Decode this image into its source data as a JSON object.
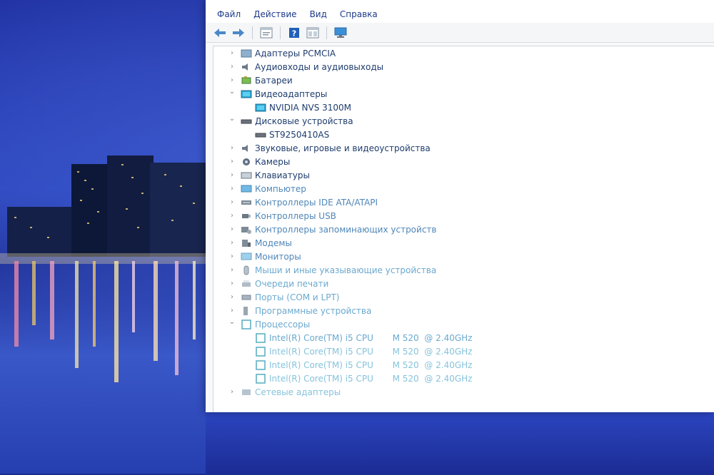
{
  "menu": {
    "file": "Файл",
    "action": "Действие",
    "view": "Вид",
    "help": "Справка"
  },
  "toolbar_icons": [
    "back-arrow-icon",
    "forward-arrow-icon",
    "properties-icon",
    "help-icon",
    "view-icon",
    "monitor-icon"
  ],
  "tree": [
    {
      "label": "Адаптеры PCMCIA",
      "level": 0,
      "expanded": false,
      "icon": "pcmcia-icon"
    },
    {
      "label": "Аудиовходы и аудиовыходы",
      "level": 0,
      "expanded": false,
      "icon": "speaker-icon"
    },
    {
      "label": "Батареи",
      "level": 0,
      "expanded": false,
      "icon": "battery-icon"
    },
    {
      "label": "Видеоадаптеры",
      "level": 0,
      "expanded": true,
      "icon": "display-adapter-icon"
    },
    {
      "label": "NVIDIA NVS 3100M",
      "level": 1,
      "icon": "display-adapter-icon"
    },
    {
      "label": "Дисковые устройства",
      "level": 0,
      "expanded": true,
      "icon": "disk-drive-icon"
    },
    {
      "label": "ST9250410AS",
      "level": 1,
      "icon": "disk-drive-icon"
    },
    {
      "label": "Звуковые, игровые и видеоустройства",
      "level": 0,
      "expanded": false,
      "icon": "speaker-icon"
    },
    {
      "label": "Камеры",
      "level": 0,
      "expanded": false,
      "icon": "camera-icon"
    },
    {
      "label": "Клавиатуры",
      "level": 0,
      "expanded": false,
      "icon": "keyboard-icon"
    },
    {
      "label": "Компьютер",
      "level": 0,
      "expanded": false,
      "icon": "computer-icon"
    },
    {
      "label": "Контроллеры IDE ATA/ATAPI",
      "level": 0,
      "expanded": false,
      "icon": "ide-controller-icon"
    },
    {
      "label": "Контроллеры USB",
      "level": 0,
      "expanded": false,
      "icon": "usb-icon"
    },
    {
      "label": "Контроллеры запоминающих устройств",
      "level": 0,
      "expanded": false,
      "icon": "storage-controller-icon"
    },
    {
      "label": "Модемы",
      "level": 0,
      "expanded": false,
      "icon": "modem-icon"
    },
    {
      "label": "Мониторы",
      "level": 0,
      "expanded": false,
      "icon": "monitor-icon"
    },
    {
      "label": "Мыши и иные указывающие устройства",
      "level": 0,
      "expanded": false,
      "icon": "mouse-icon"
    },
    {
      "label": "Очереди печати",
      "level": 0,
      "expanded": false,
      "icon": "printer-icon"
    },
    {
      "label": "Порты (COM и LPT)",
      "level": 0,
      "expanded": false,
      "icon": "port-icon"
    },
    {
      "label": "Программные устройства",
      "level": 0,
      "expanded": false,
      "icon": "software-device-icon"
    },
    {
      "label": "Процессоры",
      "level": 0,
      "expanded": true,
      "icon": "processor-icon"
    },
    {
      "label": "Intel(R) Core(TM) i5 CPU       M 520  @ 2.40GHz",
      "level": 1,
      "icon": "processor-icon"
    },
    {
      "label": "Intel(R) Core(TM) i5 CPU       M 520  @ 2.40GHz",
      "level": 1,
      "icon": "processor-icon"
    },
    {
      "label": "Intel(R) Core(TM) i5 CPU       M 520  @ 2.40GHz",
      "level": 1,
      "icon": "processor-icon"
    },
    {
      "label": "Intel(R) Core(TM) i5 CPU       M 520  @ 2.40GHz",
      "level": 1,
      "icon": "processor-icon"
    },
    {
      "label": "Сетевые адаптеры",
      "level": 0,
      "expanded": false,
      "icon": "network-adapter-icon"
    }
  ]
}
